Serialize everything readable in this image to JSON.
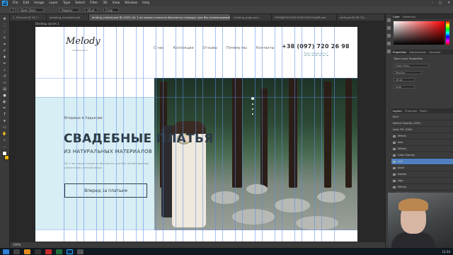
{
  "menubar": {
    "logo": "Ps",
    "items": [
      "File",
      "Edit",
      "Image",
      "Layer",
      "Type",
      "Select",
      "Filter",
      "3D",
      "View",
      "Window",
      "Help"
    ],
    "window_buttons": [
      "–",
      "□",
      "✕"
    ]
  },
  "options": {
    "font_family": "Open Sans",
    "font_style": "Regular",
    "font_size": "18 pt",
    "anti_alias": "Crisp"
  },
  "tabs": [
    {
      "label": "1. Fish.psd @ 16,7...",
      "active": false
    },
    {
      "label": "wedding_template.psd",
      "active": false
    },
    {
      "label": "landing_melody.psd @ 100% (Эс 1 на наших стилисты бесплатно создадут для Вас неповторимый... RGB/8)",
      "active": true
    },
    {
      "label": "Landing_page.psd...",
      "active": false
    },
    {
      "label": "ЮРИДИЧЕСКАЯ КОНСУЛЬТАЦИЯ.psd",
      "active": false
    },
    {
      "label": "shift.psd @ 66,7%...",
      "active": false
    }
  ],
  "artboard": {
    "label": "Desktop sonim 1"
  },
  "site": {
    "logo": "Melody",
    "logo_sub": "wedding salon",
    "nav": [
      "О нас",
      "Коллекции",
      "Отзывы",
      "Почему мы",
      "Контакты"
    ],
    "phone": "+38 (097) 720 26 98",
    "callback": "Вам позвонить?",
    "subtitle": "Впервые в Харькове",
    "heading": "СВАДЕБНЫЕ ПЛАТЬЯ",
    "heading2": "ИЗ НАТУРАЛЬНЫХ МАТЕРИАЛОВ",
    "desc": "За 1 час наши стилисты бесплатно для Вас неповторимый, целостный и легкий образ",
    "cta": "Вперед за платьем"
  },
  "panels": {
    "color_tabs": [
      "Color",
      "Swatches"
    ],
    "props_tabs": [
      "Properties",
      "Adjustments",
      "Libraries"
    ],
    "props_title": "Type Layer Properties",
    "props_rows": [
      "Open Sans",
      "Regular",
      "18 pt",
      "Auto"
    ],
    "layers_tabs": [
      "Layers",
      "Channels",
      "Paths"
    ],
    "layers": [
      {
        "name": "Kind",
        "selected": false
      },
      {
        "name": "Normal   Opacity: 100%",
        "selected": false
      },
      {
        "name": "Lock:   Fill: 100%",
        "selected": false
      },
      {
        "name": "Effects",
        "selected": false
      },
      {
        "name": "text",
        "selected": false
      },
      {
        "name": "Effects",
        "selected": false
      },
      {
        "name": "Color Overlay",
        "selected": false
      },
      {
        "name": "text",
        "selected": true
      },
      {
        "name": "block",
        "selected": false
      },
      {
        "name": "header",
        "selected": false
      },
      {
        "name": "logo",
        "selected": false
      },
      {
        "name": "Effects",
        "selected": false
      },
      {
        "name": "Color Overlay",
        "selected": false
      }
    ]
  },
  "status": {
    "zoom": "100%"
  },
  "taskbar": {
    "clock": "12:34"
  }
}
